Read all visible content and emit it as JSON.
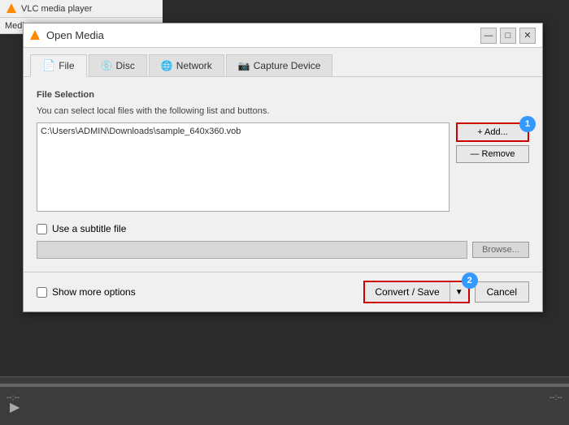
{
  "app": {
    "title": "VLC media player",
    "menu_items": [
      "Media"
    ]
  },
  "dialog": {
    "title": "Open Media",
    "tabs": [
      {
        "id": "file",
        "label": "File",
        "icon": "file-icon",
        "active": true
      },
      {
        "id": "disc",
        "label": "Disc",
        "icon": "disc-icon",
        "active": false
      },
      {
        "id": "network",
        "label": "Network",
        "icon": "network-icon",
        "active": false
      },
      {
        "id": "capture",
        "label": "Capture Device",
        "icon": "capture-icon",
        "active": false
      }
    ],
    "file_selection": {
      "section_label": "File Selection",
      "description": "You can select local files with the following list and buttons.",
      "file_path": "C:\\Users\\ADMIN\\Downloads\\sample_640x360.vob",
      "add_button": "+ Add...",
      "remove_button": "— Remove"
    },
    "subtitle": {
      "checkbox_label": "Use a subtitle file",
      "browse_button": "Browse..."
    },
    "footer": {
      "show_more_label": "Show more options",
      "convert_save_label": "Convert / Save",
      "cancel_label": "Cancel"
    }
  },
  "badges": {
    "badge1_label": "1",
    "badge2_label": "2"
  },
  "bottom_controls": {
    "time_left": "--:--",
    "time_right": "--:--",
    "play_label": "▶"
  }
}
